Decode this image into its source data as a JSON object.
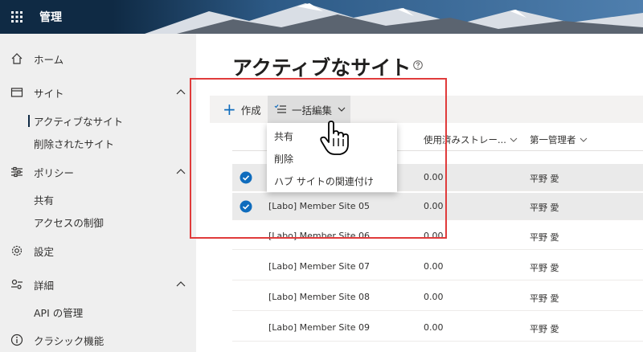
{
  "app": {
    "title": "管理"
  },
  "sidebar": {
    "items": [
      {
        "label": "ホーム",
        "icon": "home-icon"
      },
      {
        "label": "サイト",
        "icon": "site-icon",
        "expanded": true,
        "children": [
          {
            "label": "アクティブなサイト",
            "selected": true
          },
          {
            "label": "削除されたサイト"
          }
        ]
      },
      {
        "label": "ポリシー",
        "icon": "policy-icon",
        "expanded": true,
        "children": [
          {
            "label": "共有"
          },
          {
            "label": "アクセスの制御"
          }
        ]
      },
      {
        "label": "設定",
        "icon": "gear-icon"
      },
      {
        "label": "詳細",
        "icon": "advanced-icon",
        "expanded": true,
        "children": [
          {
            "label": "API の管理"
          }
        ]
      },
      {
        "label": "クラシック機能",
        "icon": "info-icon"
      }
    ]
  },
  "main": {
    "title": "アクティブなサイト",
    "commands": {
      "create": "作成",
      "bulk_edit": "一括編集"
    },
    "columns": {
      "storage": "使用済みストレー...",
      "primary_admin": "第一管理者"
    },
    "rows": [
      {
        "site": "",
        "storage": "0.00",
        "admin": "平野 愛",
        "selected": true
      },
      {
        "site": "[Labo] Member Site 05",
        "storage": "0.00",
        "admin": "平野 愛",
        "selected": true
      },
      {
        "site": "[Labo] Member Site 06",
        "storage": "0.00",
        "admin": "平野 愛",
        "selected": false
      },
      {
        "site": "[Labo] Member Site 07",
        "storage": "0.00",
        "admin": "平野 愛",
        "selected": false
      },
      {
        "site": "[Labo] Member Site 08",
        "storage": "0.00",
        "admin": "平野 愛",
        "selected": false
      },
      {
        "site": "[Labo] Member Site 09",
        "storage": "0.00",
        "admin": "平野 愛",
        "selected": false
      }
    ],
    "dropdown": [
      "共有",
      "削除",
      "ハブ サイトの関連付け"
    ]
  },
  "colors": {
    "topbar": "#0f2a44",
    "accent": "#0f6cbd",
    "highlight": "#e03b3b",
    "sidebar": "#efefef"
  }
}
